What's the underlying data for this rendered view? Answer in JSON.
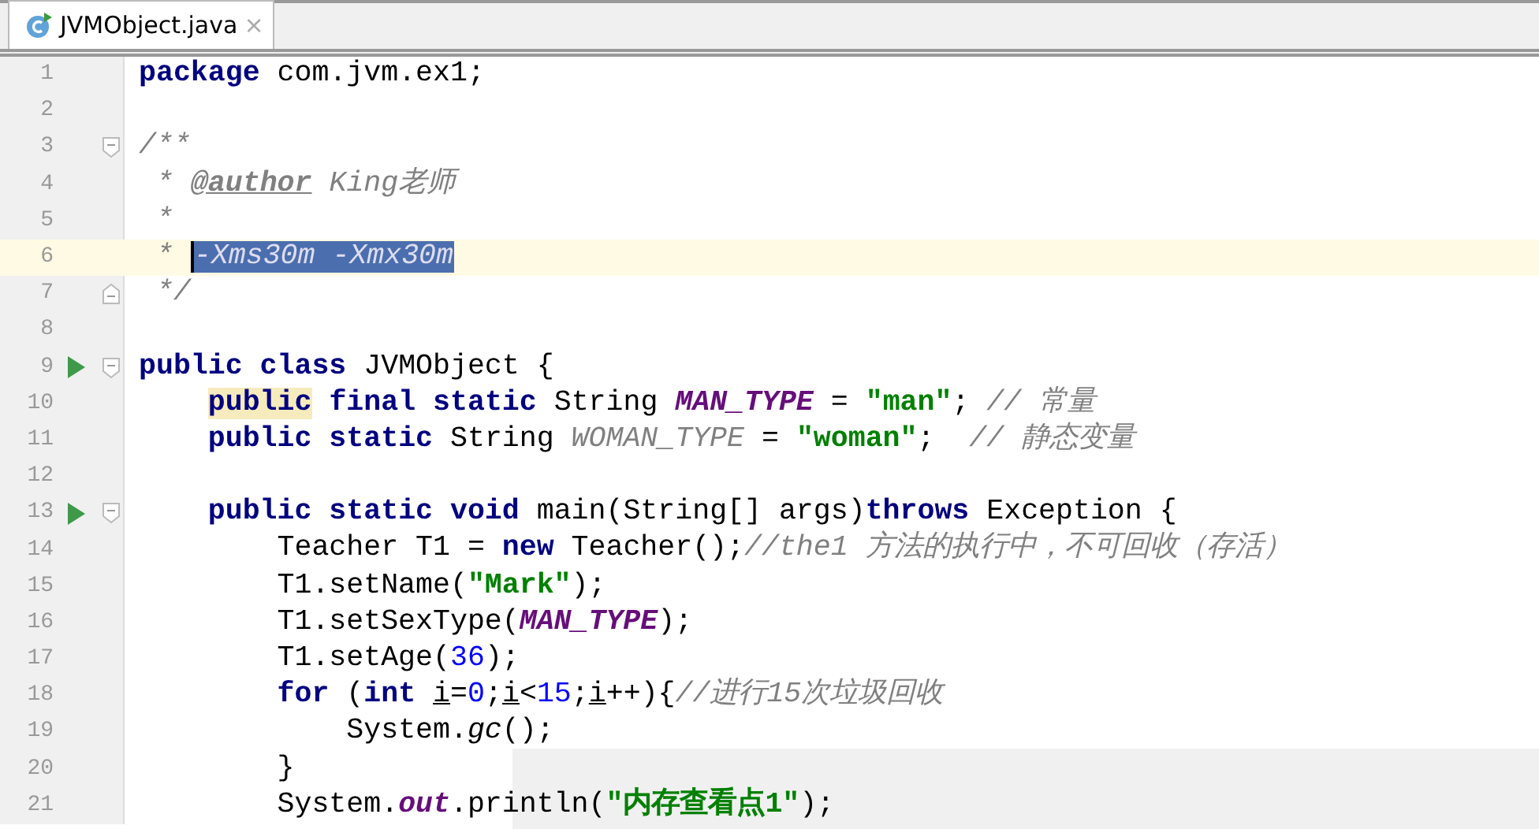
{
  "tabs": [
    {
      "label": "JVMObject.java",
      "selected": true,
      "close": "×"
    }
  ],
  "lines": [
    {
      "number": "1",
      "tokens": [
        {
          "text": "package",
          "kind": "keyword"
        },
        {
          "text": " com.jvm.ex1;",
          "kind": "plain"
        }
      ]
    },
    {
      "number": "2"
    },
    {
      "number": "3",
      "fold_start": true,
      "tokens": [
        {
          "text": "/**",
          "kind": "comment"
        }
      ]
    },
    {
      "number": "4",
      "tokens": [
        {
          "text": " * ",
          "kind": "comment"
        },
        {
          "text": "@author",
          "kind": "doc_tag"
        },
        {
          "text": " King老师",
          "kind": "comment"
        }
      ]
    },
    {
      "number": "5",
      "tokens": [
        {
          "text": " *",
          "kind": "comment"
        }
      ]
    },
    {
      "number": "6",
      "current": true,
      "tokens": [
        {
          "text": " * ",
          "kind": "comment"
        },
        {
          "text": "-Xms30m -Xmx30m",
          "kind": "selected"
        }
      ]
    },
    {
      "number": "7",
      "fold_end": true,
      "tokens": [
        {
          "text": " */",
          "kind": "comment"
        }
      ]
    },
    {
      "number": "8"
    },
    {
      "number": "9",
      "run": true,
      "fold_start": true,
      "tokens": [
        {
          "text": "public class",
          "kind": "keyword"
        },
        {
          "text": " JVMObject {",
          "kind": "plain"
        }
      ]
    },
    {
      "number": "10",
      "tokens": [
        {
          "text": "    public",
          "kind": "keyword_hl"
        },
        {
          "text": " final static",
          "kind": "keyword"
        },
        {
          "text": " String ",
          "kind": "plain"
        },
        {
          "text": "MAN_TYPE",
          "kind": "const"
        },
        {
          "text": " = ",
          "kind": "plain"
        },
        {
          "text": "\"man\"",
          "kind": "string"
        },
        {
          "text": "; ",
          "kind": "plain"
        },
        {
          "text": "// 常量",
          "kind": "comment"
        }
      ]
    },
    {
      "number": "11",
      "tokens": [
        {
          "text": "    public static",
          "kind": "keyword"
        },
        {
          "text": " String ",
          "kind": "plain"
        },
        {
          "text": "WOMAN_TYPE",
          "kind": "unused"
        },
        {
          "text": " = ",
          "kind": "plain"
        },
        {
          "text": "\"woman\"",
          "kind": "string"
        },
        {
          "text": ";  ",
          "kind": "plain"
        },
        {
          "text": "// 静态变量",
          "kind": "comment"
        }
      ]
    },
    {
      "number": "12"
    },
    {
      "number": "13",
      "run": true,
      "fold_start": true,
      "tokens": [
        {
          "text": "    public static void",
          "kind": "keyword"
        },
        {
          "text": " main(String[] args)",
          "kind": "plain"
        },
        {
          "text": "throws",
          "kind": "keyword"
        },
        {
          "text": " Exception {",
          "kind": "plain"
        }
      ]
    },
    {
      "number": "14",
      "tokens": [
        {
          "text": "        Teacher T1 = ",
          "kind": "plain"
        },
        {
          "text": "new",
          "kind": "keyword"
        },
        {
          "text": " Teacher();",
          "kind": "plain"
        },
        {
          "text": "//the1 方法的执行中，不可回收（存活）",
          "kind": "comment"
        }
      ]
    },
    {
      "number": "15",
      "tokens": [
        {
          "text": "        T1.setName(",
          "kind": "plain"
        },
        {
          "text": "\"Mark\"",
          "kind": "string"
        },
        {
          "text": ");",
          "kind": "plain"
        }
      ]
    },
    {
      "number": "16",
      "tokens": [
        {
          "text": "        T1.setSexType(",
          "kind": "plain"
        },
        {
          "text": "MAN_TYPE",
          "kind": "const"
        },
        {
          "text": ");",
          "kind": "plain"
        }
      ]
    },
    {
      "number": "17",
      "tokens": [
        {
          "text": "        T1.setAge(",
          "kind": "plain"
        },
        {
          "text": "36",
          "kind": "number"
        },
        {
          "text": ");",
          "kind": "plain"
        }
      ]
    },
    {
      "number": "18",
      "tokens": [
        {
          "text": "        for",
          "kind": "keyword"
        },
        {
          "text": " (",
          "kind": "plain"
        },
        {
          "text": "int ",
          "kind": "keyword"
        },
        {
          "text": "i",
          "kind": "var"
        },
        {
          "text": "=",
          "kind": "plain"
        },
        {
          "text": "0",
          "kind": "number"
        },
        {
          "text": ";",
          "kind": "plain"
        },
        {
          "text": "i",
          "kind": "var"
        },
        {
          "text": "<",
          "kind": "plain"
        },
        {
          "text": "15",
          "kind": "number"
        },
        {
          "text": ";",
          "kind": "plain"
        },
        {
          "text": "i",
          "kind": "var"
        },
        {
          "text": "++){",
          "kind": "plain"
        },
        {
          "text": "//进行15次垃圾回收",
          "kind": "comment"
        }
      ]
    },
    {
      "number": "19",
      "tokens": [
        {
          "text": "            System.",
          "kind": "plain"
        },
        {
          "text": "gc",
          "kind": "static_method"
        },
        {
          "text": "();",
          "kind": "plain"
        }
      ]
    },
    {
      "number": "20",
      "tokens": [
        {
          "text": "        }",
          "kind": "plain"
        }
      ]
    },
    {
      "number": "21",
      "tokens": [
        {
          "text": "        System.",
          "kind": "plain"
        },
        {
          "text": "out",
          "kind": "const"
        },
        {
          "text": ".println(",
          "kind": "plain"
        },
        {
          "text": "\"内存查看点1\"",
          "kind": "string"
        },
        {
          "text": ");",
          "kind": "plain"
        }
      ]
    }
  ]
}
